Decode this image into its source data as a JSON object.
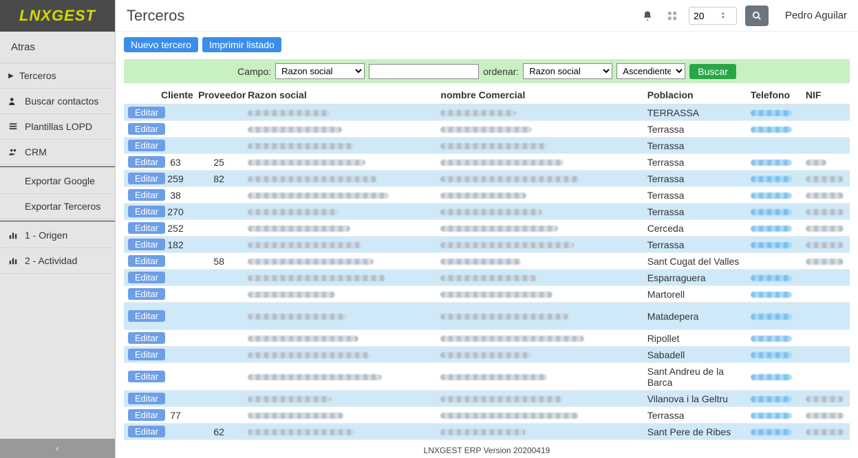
{
  "app": {
    "logo": "LNXGEST",
    "footer": "LNXGEST ERP Version 20200419"
  },
  "header": {
    "title": "Terceros",
    "page_number": "20",
    "user": "Pedro Aguilar"
  },
  "sidebar": {
    "back": "Atras",
    "items": [
      {
        "icon": "▶",
        "label": "Terceros",
        "caret": true
      },
      {
        "icon": "users",
        "label": "Buscar contactos"
      },
      {
        "icon": "list",
        "label": "Plantillas LOPD"
      },
      {
        "icon": "users",
        "label": "CRM"
      }
    ],
    "items2": [
      {
        "icon": "download",
        "label": "Exportar Google"
      },
      {
        "icon": "download",
        "label": "Exportar Terceros"
      }
    ],
    "items3": [
      {
        "icon": "chart",
        "label": "1 - Origen"
      },
      {
        "icon": "chart",
        "label": "2 - Actividad"
      }
    ]
  },
  "actions": {
    "nuevo": "Nuevo tercero",
    "imprimir": "Imprimir listado"
  },
  "filter": {
    "campo_label": "Campo:",
    "campo_value": "Razon social",
    "text_value": "",
    "ordenar_label": "ordenar:",
    "ordenar_value": "Razon social",
    "dir_value": "Ascendiente",
    "buscar": "Buscar"
  },
  "table": {
    "headers": {
      "cliente": "Cliente",
      "proveedor": "Proveedor",
      "razon": "Razon social",
      "nombre": "nombre Comercial",
      "poblacion": "Poblacion",
      "telefono": "Telefono",
      "nif": "NIF"
    },
    "edit_label": "Editar",
    "rows": [
      {
        "cliente": "",
        "proveedor": "",
        "poblacion": "TERRASSA",
        "tel": true,
        "nif": false
      },
      {
        "cliente": "",
        "proveedor": "",
        "poblacion": "Terrassa",
        "tel": true,
        "nif": false
      },
      {
        "cliente": "",
        "proveedor": "",
        "poblacion": "Terrassa",
        "tel": false,
        "nif": false
      },
      {
        "cliente": "63",
        "proveedor": "25",
        "poblacion": "Terrassa",
        "tel": true,
        "nif": true,
        "nifsmall": true
      },
      {
        "cliente": "259",
        "proveedor": "82",
        "poblacion": "Terrassa",
        "tel": true,
        "nif": true
      },
      {
        "cliente": "38",
        "proveedor": "",
        "poblacion": "Terrassa",
        "tel": true,
        "nif": true
      },
      {
        "cliente": "270",
        "proveedor": "",
        "poblacion": "Terrassa",
        "tel": true,
        "nif": true
      },
      {
        "cliente": "252",
        "proveedor": "",
        "poblacion": "Cerceda",
        "tel": true,
        "nif": true
      },
      {
        "cliente": "182",
        "proveedor": "",
        "poblacion": "Terrassa",
        "tel": true,
        "nif": true
      },
      {
        "cliente": "",
        "proveedor": "58",
        "poblacion": "Sant Cugat del Valles",
        "tel": false,
        "nif": true
      },
      {
        "cliente": "",
        "proveedor": "",
        "poblacion": "Esparraguera",
        "tel": true,
        "nif": false
      },
      {
        "cliente": "",
        "proveedor": "",
        "poblacion": "Martorell",
        "tel": true,
        "nif": false
      },
      {
        "cliente": "",
        "proveedor": "",
        "poblacion": "Matadepera",
        "tel": true,
        "nif": false,
        "tall": true
      },
      {
        "cliente": "",
        "proveedor": "",
        "poblacion": "Ripollet",
        "tel": true,
        "nif": false
      },
      {
        "cliente": "",
        "proveedor": "",
        "poblacion": "Sabadell",
        "tel": true,
        "nif": false
      },
      {
        "cliente": "",
        "proveedor": "",
        "poblacion": "Sant Andreu de la Barca",
        "tel": true,
        "nif": false,
        "tall": true
      },
      {
        "cliente": "",
        "proveedor": "",
        "poblacion": "Vilanova i la Geltru",
        "tel": true,
        "nif": true
      },
      {
        "cliente": "77",
        "proveedor": "",
        "poblacion": "Terrassa",
        "tel": true,
        "nif": true
      },
      {
        "cliente": "",
        "proveedor": "62",
        "poblacion": "Sant Pere de Ribes",
        "tel": true,
        "nif": true
      }
    ]
  }
}
